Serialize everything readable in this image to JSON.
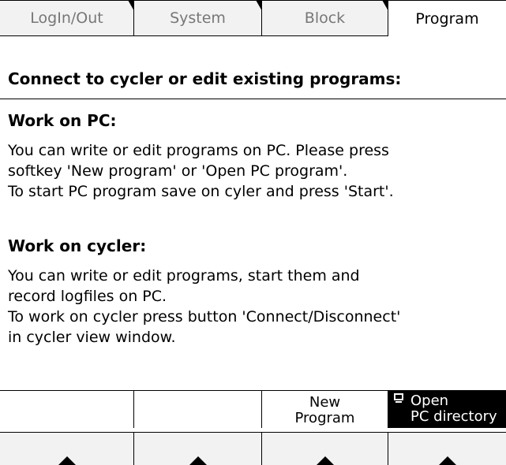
{
  "tabs": [
    {
      "label": "LogIn/Out",
      "active": false
    },
    {
      "label": "System",
      "active": false
    },
    {
      "label": "Block",
      "active": false
    },
    {
      "label": "Program",
      "active": true
    }
  ],
  "heading": "Connect to cycler or edit existing programs:",
  "sections": [
    {
      "title": "Work on PC:",
      "text": "You can write or edit programs on PC. Please press\nsoftkey 'New program' or 'Open PC program'.\nTo start PC program save on cyler and press 'Start'."
    },
    {
      "title": "Work on cycler:",
      "text": "You can write or edit programs, start them and\nrecord logfiles on PC.\nTo work on cycler press button 'Connect/Disconnect'\nin cycler view window."
    }
  ],
  "softkeys": [
    {
      "label": ""
    },
    {
      "label": ""
    },
    {
      "label": "New\nProgram"
    },
    {
      "label": "Open\nPC directory",
      "icon": "monitor-icon"
    }
  ],
  "arrow_buttons": [
    {
      "icon": "up-arrow-icon"
    },
    {
      "icon": "up-arrow-icon"
    },
    {
      "icon": "up-arrow-icon"
    },
    {
      "icon": "up-arrow-icon"
    }
  ]
}
